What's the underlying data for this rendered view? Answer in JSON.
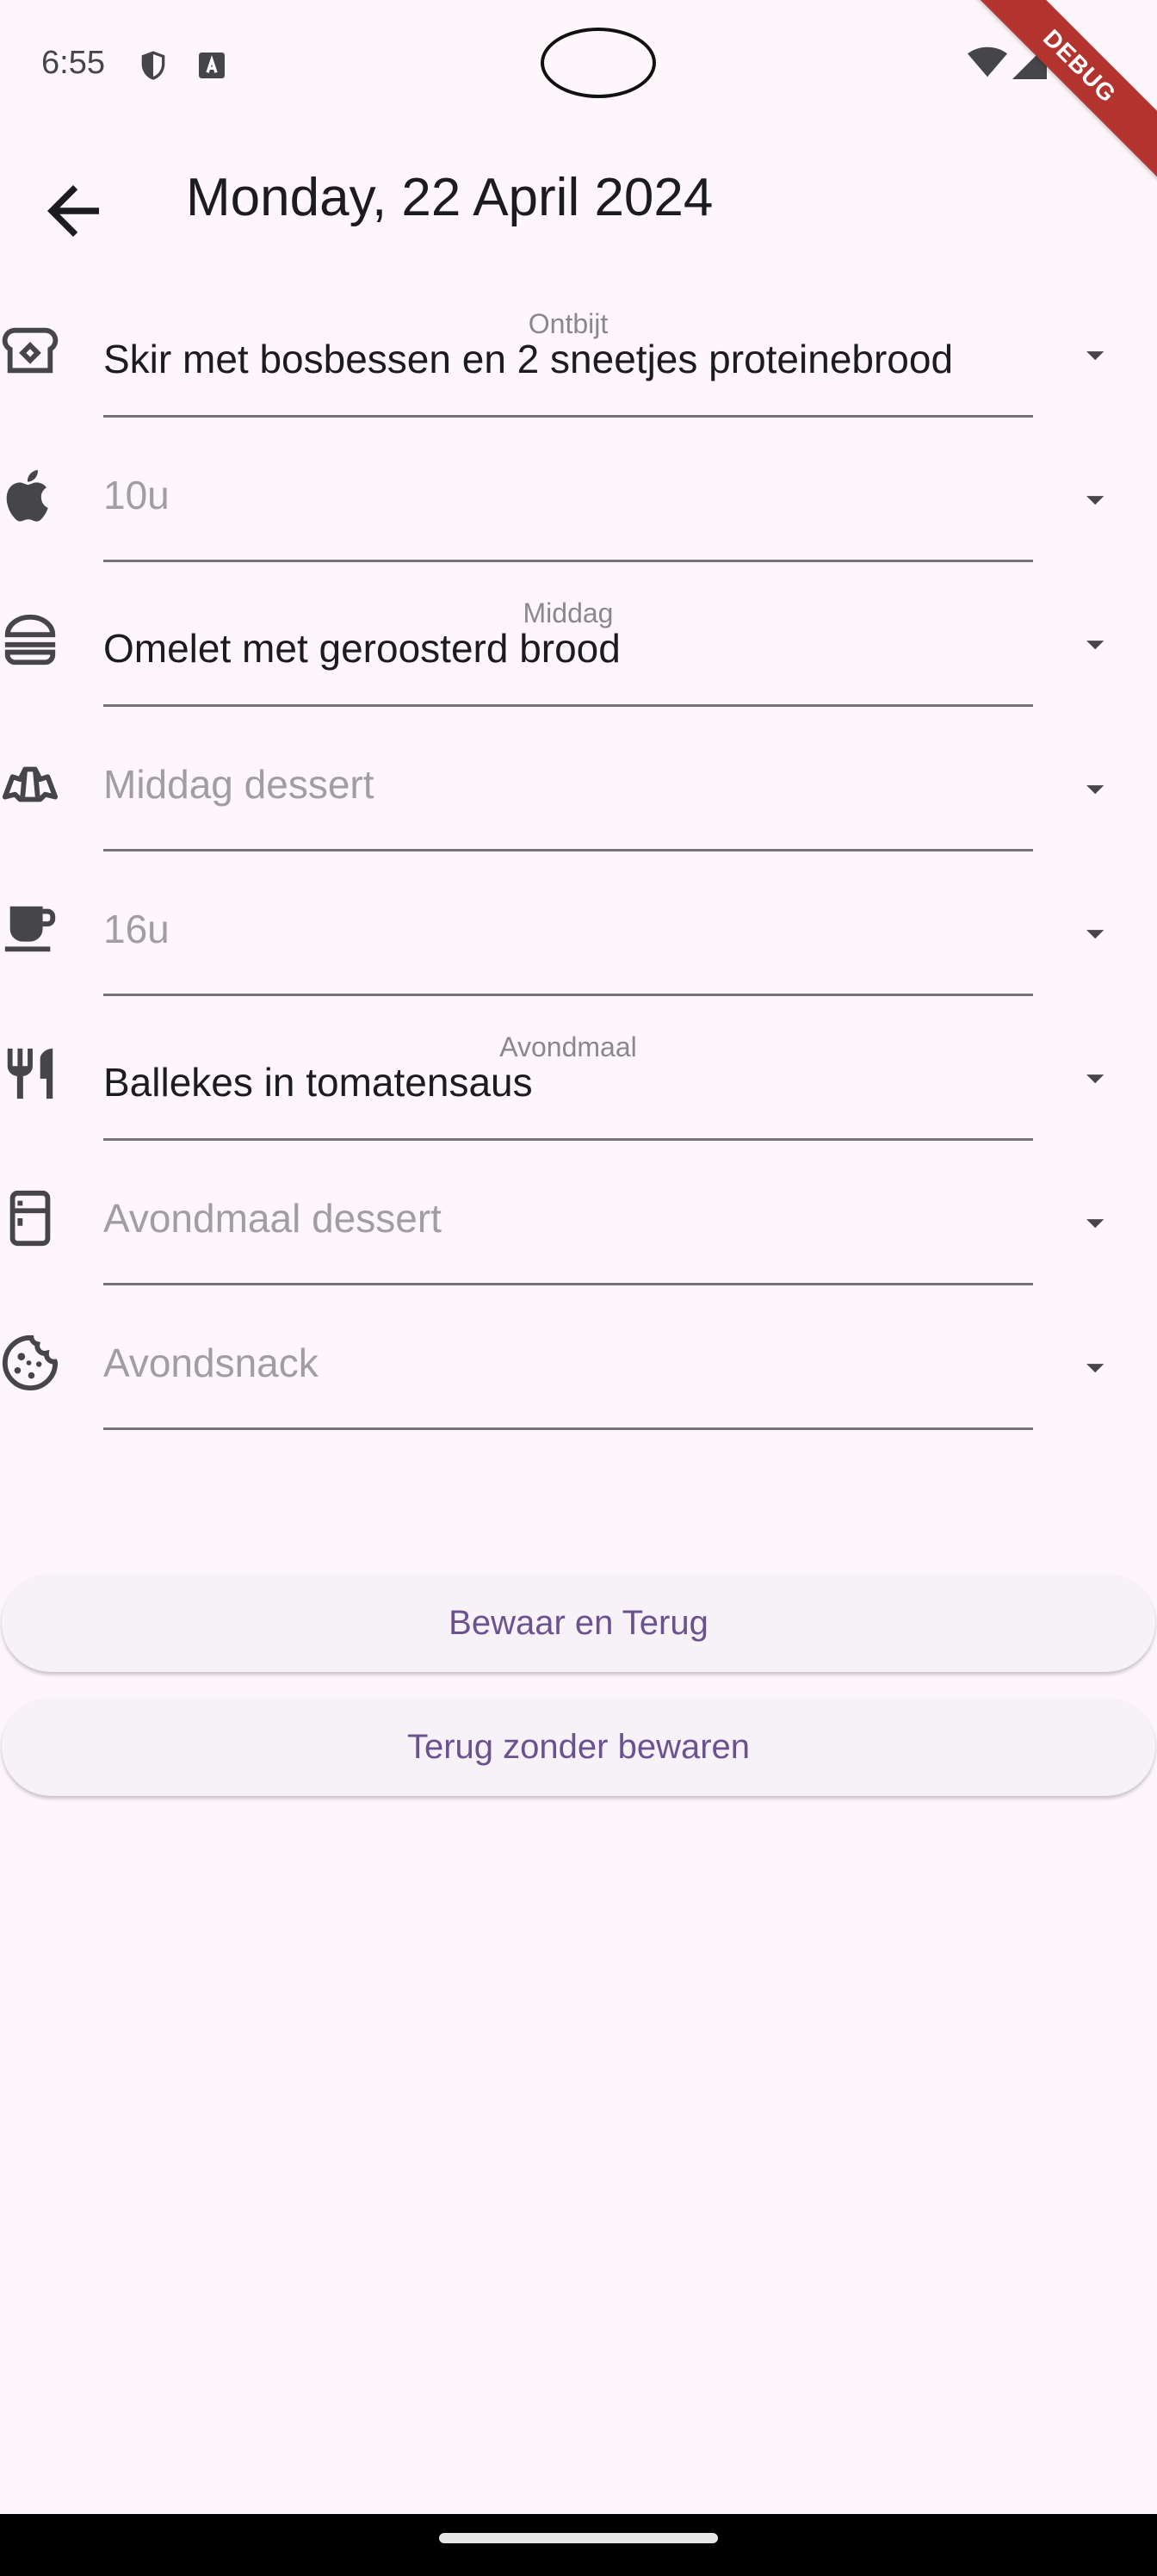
{
  "status_bar": {
    "time": "6:55",
    "debug_label": "DEBUG"
  },
  "app_bar": {
    "title": "Monday, 22 April 2024"
  },
  "meals": [
    {
      "icon": "bread-icon",
      "label": "Ontbijt",
      "value": "Skir met bosbessen en 2 sneetjes proteinebrood",
      "placeholder": ""
    },
    {
      "icon": "apple-icon",
      "label": "",
      "value": "",
      "placeholder": "10u"
    },
    {
      "icon": "burger-icon",
      "label": "Middag",
      "value": "Omelet met geroosterd brood",
      "placeholder": ""
    },
    {
      "icon": "croissant-icon",
      "label": "",
      "value": "",
      "placeholder": "Middag dessert"
    },
    {
      "icon": "coffee-icon",
      "label": "",
      "value": "",
      "placeholder": "16u"
    },
    {
      "icon": "restaurant-icon",
      "label": "Avondmaal",
      "value": "Ballekes in tomatensaus",
      "placeholder": ""
    },
    {
      "icon": "fridge-icon",
      "label": "",
      "value": "",
      "placeholder": "Avondmaal dessert"
    },
    {
      "icon": "cookie-icon",
      "label": "",
      "value": "",
      "placeholder": "Avondsnack"
    }
  ],
  "buttons": {
    "save_back": "Bewaar en Terug",
    "back_no_save": "Terug zonder bewaren"
  },
  "colors": {
    "background": "#fdf7fc",
    "button_text": "#6a528f",
    "underline": "#75737a"
  }
}
